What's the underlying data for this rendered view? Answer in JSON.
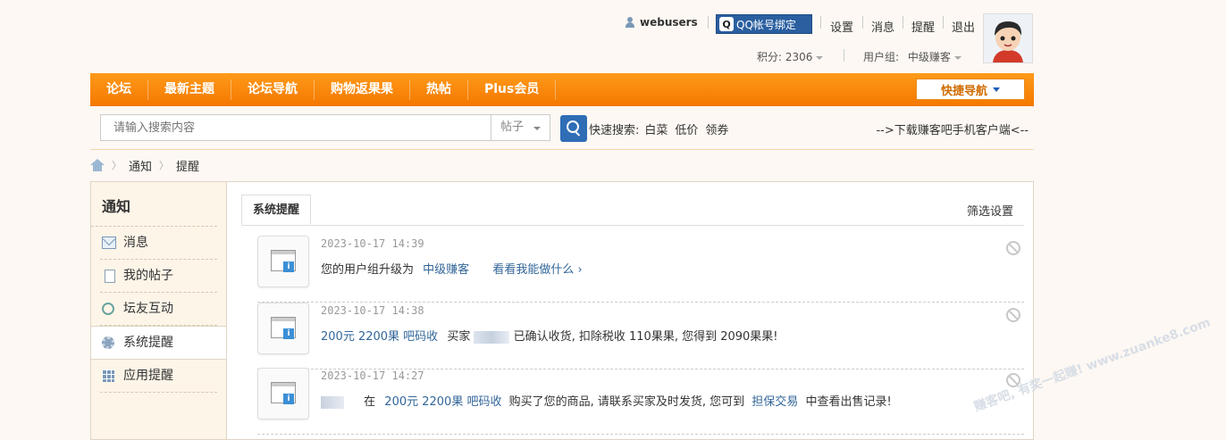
{
  "user": {
    "name": "webusers",
    "qq_bind": "QQ帐号绑定",
    "links": [
      "设置",
      "消息",
      "提醒",
      "退出"
    ],
    "points_label": "积分:",
    "points": "2306",
    "group_label": "用户组:",
    "group": "中级赚客"
  },
  "nav": {
    "items": [
      "论坛",
      "最新主题",
      "论坛导航",
      "购物返果果",
      "热帖",
      "Plus会员"
    ],
    "quick_nav": "快捷导航"
  },
  "search": {
    "placeholder": "请输入搜索内容",
    "type": "帖子",
    "quick_label": "快速搜索:",
    "quick_terms": [
      "白菜",
      "低价",
      "领券"
    ],
    "download": "-->下载赚客吧手机客户端<--"
  },
  "breadcrumb": [
    "通知",
    "提醒"
  ],
  "sidebar": {
    "title": "通知",
    "items": [
      {
        "label": "消息",
        "icon": "mail-icon"
      },
      {
        "label": "我的帖子",
        "icon": "document-icon"
      },
      {
        "label": "坛友互动",
        "icon": "recycle-icon"
      },
      {
        "label": "系统提醒",
        "icon": "gear-icon"
      },
      {
        "label": "应用提醒",
        "icon": "grid-icon"
      }
    ]
  },
  "main": {
    "tab": "系统提醒",
    "filter": "筛选设置"
  },
  "notices": [
    {
      "time": "2023-10-17 14:39",
      "prefix": "您的用户组升级为",
      "group": "中级赚客",
      "link": "看看我能做什么 ›"
    },
    {
      "time": "2023-10-17 14:38",
      "item": "200元 2200果 吧码收",
      "buyer_label": "买家",
      "tail": "已确认收货, 扣除税收 110果果, 您得到 2090果果!"
    },
    {
      "time": "2023-10-17 14:27",
      "at": "在",
      "item": "200元 2200果 吧码收",
      "mid": "购买了您的商品, 请联系买家及时发货, 您可到",
      "link": "担保交易",
      "tail": "中查看出售记录!"
    }
  ],
  "watermark": "赚客吧, 有奖一起赚! www.zuanke8.com"
}
